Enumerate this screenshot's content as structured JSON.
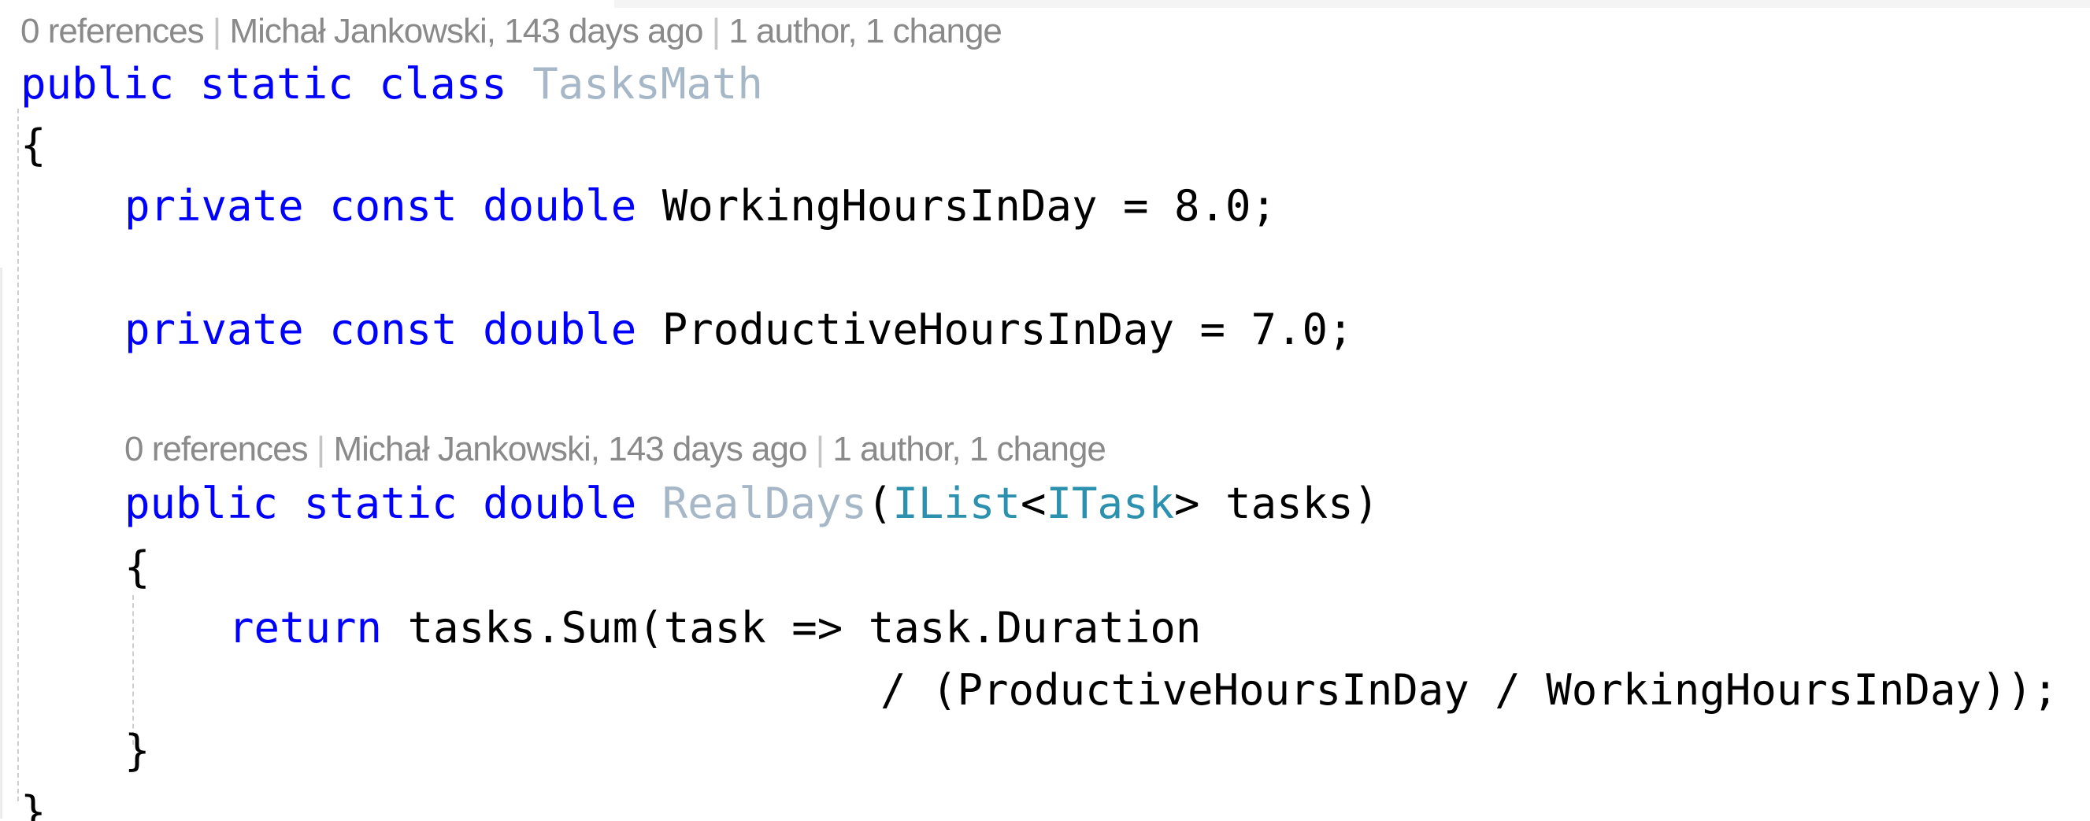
{
  "codelens": {
    "class": {
      "references": "0 references",
      "separator": " | ",
      "author_time": "Michał Jankowski, 143 days ago",
      "changes": "1 author, 1 change"
    },
    "method": {
      "references": "0 references",
      "separator": " | ",
      "author_time": "Michał Jankowski, 143 days ago",
      "changes": "1 author, 1 change"
    }
  },
  "code": {
    "class_decl": {
      "kw_public": "public",
      "kw_static": "static",
      "kw_class": "class",
      "name": "TasksMath"
    },
    "open_brace": "{",
    "const1": {
      "kw_private": "private",
      "kw_const": "const",
      "kw_double": "double",
      "rest": "WorkingHoursInDay = 8.0;"
    },
    "const2": {
      "kw_private": "private",
      "kw_const": "const",
      "kw_double": "double",
      "rest": "ProductiveHoursInDay = 7.0;"
    },
    "method_decl": {
      "kw_public": "public",
      "kw_static": "static",
      "kw_double": "double",
      "name": "RealDays",
      "paren_open": "(",
      "param_type": "IList",
      "lt": "<",
      "generic_type": "ITask",
      "gt_name_close": "> tasks)"
    },
    "method_open_brace": "{",
    "return_line": {
      "kw_return": "return",
      "rest": "tasks.Sum(task => task.Duration"
    },
    "continuation": "/ (ProductiveHoursInDay / WorkingHoursInDay));",
    "method_close_brace": "}",
    "close_brace": "}"
  },
  "colors": {
    "keyword": "#0000ff",
    "type": "#2b91af",
    "declaration_name": "#a6b8c8",
    "identifier": "#000000",
    "codelens": "#8a8a8a",
    "background": "#ffffff"
  }
}
